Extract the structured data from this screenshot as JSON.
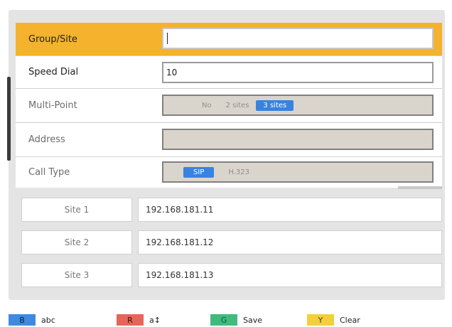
{
  "form": {
    "group_site": {
      "label": "Group/Site",
      "value": ""
    },
    "speed_dial": {
      "label": "Speed Dial",
      "value": "10"
    },
    "multi_point": {
      "label": "Multi-Point",
      "options": [
        "No",
        "2 sites",
        "3 sites"
      ],
      "selected": "3 sites"
    },
    "address": {
      "label": "Address",
      "value": ""
    },
    "call_type": {
      "label": "Call Type",
      "options": [
        "SIP",
        "H.323"
      ],
      "selected": "SIP"
    }
  },
  "sites": [
    {
      "label": "Site 1",
      "address": "192.168.181.11"
    },
    {
      "label": "Site 2",
      "address": "192.168.181.12"
    },
    {
      "label": "Site 3",
      "address": "192.168.181.13"
    }
  ],
  "footer": {
    "blue": {
      "key": "B",
      "text": "abc"
    },
    "red": {
      "key": "R",
      "text": "a↕"
    },
    "green": {
      "key": "G",
      "text": "Save"
    },
    "yellow": {
      "key": "Y",
      "text": "Clear"
    }
  },
  "colors": {
    "highlight": "#f4b22d",
    "selected_option": "#3a82e0",
    "key_blue": "#3f8ae0",
    "key_red": "#e6655a",
    "key_green": "#3fbc7d",
    "key_yellow": "#f3cf3c"
  }
}
